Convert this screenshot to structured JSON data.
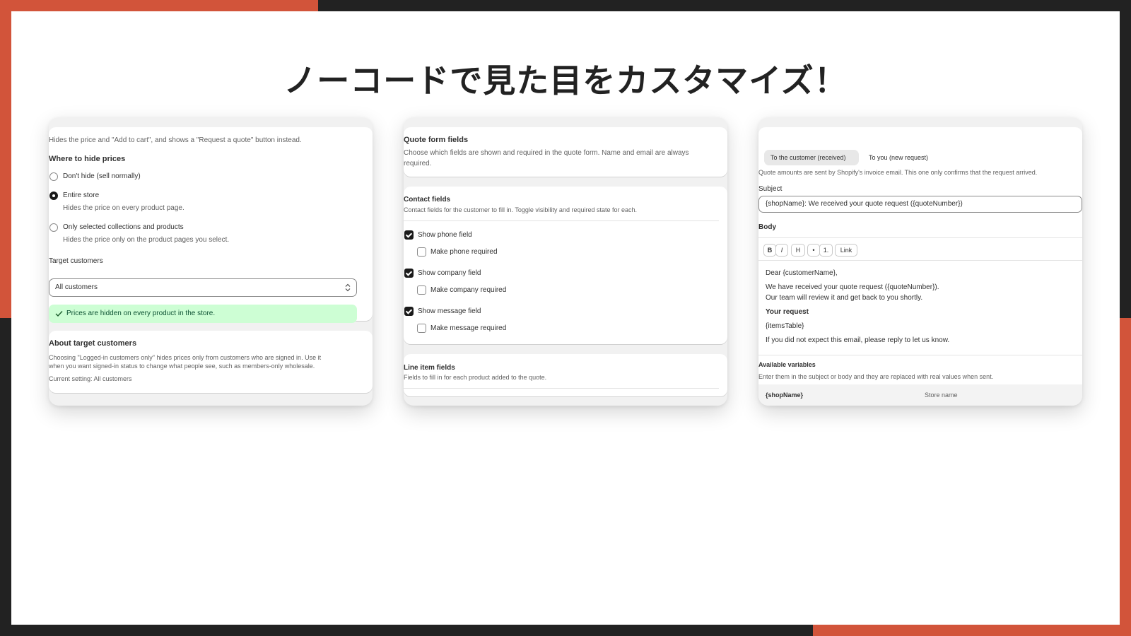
{
  "slide": {
    "title": "ノーコードで見た目をカスタマイズ！",
    "colors": {
      "accent": "#d2543a",
      "frame": "#222222",
      "success_bg": "#cdfed4"
    }
  },
  "panel1": {
    "intro": "Hides the price and \"Add to cart\", and shows a \"Request a quote\" button instead.",
    "where_heading": "Where to hide prices",
    "options": [
      {
        "label": "Don't hide (sell normally)",
        "help": "",
        "selected": false
      },
      {
        "label": "Entire store",
        "help": "Hides the price on every product page.",
        "selected": true
      },
      {
        "label": "Only selected collections and products",
        "help": "Hides the price only on the product pages you select.",
        "selected": false
      }
    ],
    "target_label": "Target customers",
    "target_value": "All customers",
    "banner_text": "Prices are hidden on every product in the store.",
    "about_heading": "About target customers",
    "about_line1": "Choosing \"Logged-in customers only\" hides prices only from customers who are signed in. Use it",
    "about_line2": "when you want signed-in status to change what people see, such as members-only wholesale.",
    "current_setting": "Current setting: All customers"
  },
  "panel2": {
    "heading": "Quote form fields",
    "desc_line1": "Choose which fields are shown and required in the quote form. Name and email are always",
    "desc_line2": "required.",
    "contact_heading": "Contact fields",
    "contact_desc": "Contact fields for the customer to fill in. Toggle visibility and required state for each.",
    "fields": [
      {
        "show_label": "Show phone field",
        "show_checked": true,
        "req_label": "Make phone required",
        "req_checked": false
      },
      {
        "show_label": "Show company field",
        "show_checked": true,
        "req_label": "Make company required",
        "req_checked": false
      },
      {
        "show_label": "Show message field",
        "show_checked": true,
        "req_label": "Make message required",
        "req_checked": false
      }
    ],
    "line_heading": "Line item fields",
    "line_desc": "Fields to fill in for each product added to the quote."
  },
  "panel3": {
    "tabs": [
      "To the customer (received)",
      "To you (new request)"
    ],
    "note": "Quote amounts are sent by Shopify's invoice email. This one only confirms that the request arrived.",
    "subject_label": "Subject",
    "subject_value": "{shopName}: We received your quote request ({quoteNumber})",
    "body_label": "Body",
    "toolbar": [
      "B",
      "I",
      "H",
      "•",
      "1.",
      "Link"
    ],
    "body": {
      "greeting": "Dear {customerName},",
      "line1": "We have received your quote request ({quoteNumber}).",
      "line2": "Our team will review it and get back to you shortly.",
      "request_heading": "Your request",
      "items": "{itemsTable}",
      "closing": "If you did not expect this email, please reply to let us know."
    },
    "vars_heading": "Available variables",
    "vars_desc": "Enter them in the subject or body and they are replaced with real values when sent.",
    "variables": [
      {
        "name": "{shopName}",
        "desc": "Store name"
      }
    ]
  }
}
